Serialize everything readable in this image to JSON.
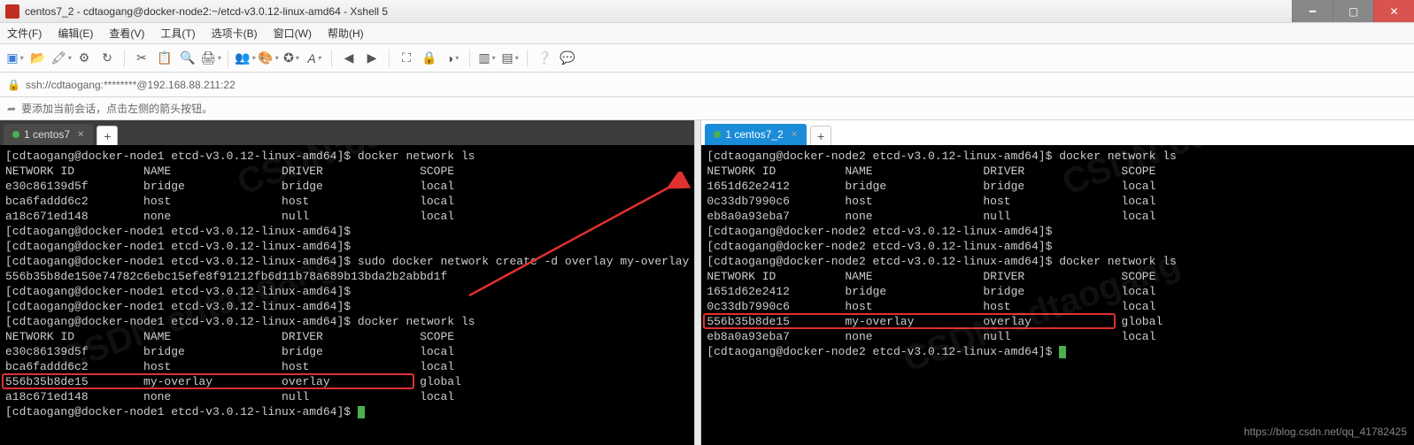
{
  "titlebar": {
    "text": "centos7_2 - cdtaogang@docker-node2:~/etcd-v3.0.12-linux-amd64 - Xshell 5"
  },
  "win_controls": {
    "min": "━",
    "max": "▢",
    "close": "✕"
  },
  "menubar": {
    "file": "文件(F)",
    "edit": "编辑(E)",
    "view": "查看(V)",
    "tools": "工具(T)",
    "tabs": "选项卡(B)",
    "window": "窗口(W)",
    "help": "帮助(H)"
  },
  "addrbar": {
    "text": "ssh://cdtaogang:********@192.168.88.211:22"
  },
  "infobar": {
    "text": "要添加当前会话，点击左侧的箭头按钮。"
  },
  "left": {
    "tab": {
      "label": "1 centos7"
    },
    "add": "+",
    "term_text": "[cdtaogang@docker-node1 etcd-v3.0.12-linux-amd64]$ docker network ls\nNETWORK ID          NAME                DRIVER              SCOPE\ne30c86139d5f        bridge              bridge              local\nbca6faddd6c2        host                host                local\na18c671ed148        none                null                local\n[cdtaogang@docker-node1 etcd-v3.0.12-linux-amd64]$ \n[cdtaogang@docker-node1 etcd-v3.0.12-linux-amd64]$ \n[cdtaogang@docker-node1 etcd-v3.0.12-linux-amd64]$ sudo docker network create -d overlay my-overlay\n556b35b8de150e74782c6ebc15efe8f91212fb6d11b78a689b13bda2b2abbd1f\n[cdtaogang@docker-node1 etcd-v3.0.12-linux-amd64]$ \n[cdtaogang@docker-node1 etcd-v3.0.12-linux-amd64]$ \n[cdtaogang@docker-node1 etcd-v3.0.12-linux-amd64]$ docker network ls\nNETWORK ID          NAME                DRIVER              SCOPE\ne30c86139d5f        bridge              bridge              local\nbca6faddd6c2        host                host                local\n556b35b8de15        my-overlay          overlay             global\na18c671ed148        none                null                local\n[cdtaogang@docker-node1 etcd-v3.0.12-linux-amd64]$ ",
    "highlight_row": {
      "network_id": "556b35b8de15",
      "name": "my-overlay",
      "driver": "overlay",
      "scope": "global"
    }
  },
  "right": {
    "tab": {
      "label": "1 centos7_2"
    },
    "add": "+",
    "term_text": "[cdtaogang@docker-node2 etcd-v3.0.12-linux-amd64]$ docker network ls\nNETWORK ID          NAME                DRIVER              SCOPE\n1651d62e2412        bridge              bridge              local\n0c33db7990c6        host                host                local\neb8a0a93eba7        none                null                local\n[cdtaogang@docker-node2 etcd-v3.0.12-linux-amd64]$ \n[cdtaogang@docker-node2 etcd-v3.0.12-linux-amd64]$ \n[cdtaogang@docker-node2 etcd-v3.0.12-linux-amd64]$ docker network ls\nNETWORK ID          NAME                DRIVER              SCOPE\n1651d62e2412        bridge              bridge              local\n0c33db7990c6        host                host                local\n556b35b8de15        my-overlay          overlay             global\neb8a0a93eba7        none                null                local\n[cdtaogang@docker-node2 etcd-v3.0.12-linux-amd64]$ ",
    "highlight_row": {
      "network_id": "556b35b8de15",
      "name": "my-overlay",
      "driver": "overlay",
      "scope": "global"
    }
  },
  "watermark": "CSDN:cdtaogang",
  "blog_url": "https://blog.csdn.net/qq_41782425",
  "colors": {
    "titlebar_active": "#1a8cd8",
    "close_btn": "#d9534f",
    "terminal_bg": "#000000",
    "terminal_fg": "#cccccc",
    "cursor": "#4caf50",
    "highlight_border": "#e03030",
    "arrow": "#e03030"
  },
  "icons": {
    "lock": "🔒",
    "arrow_right": "➦"
  }
}
